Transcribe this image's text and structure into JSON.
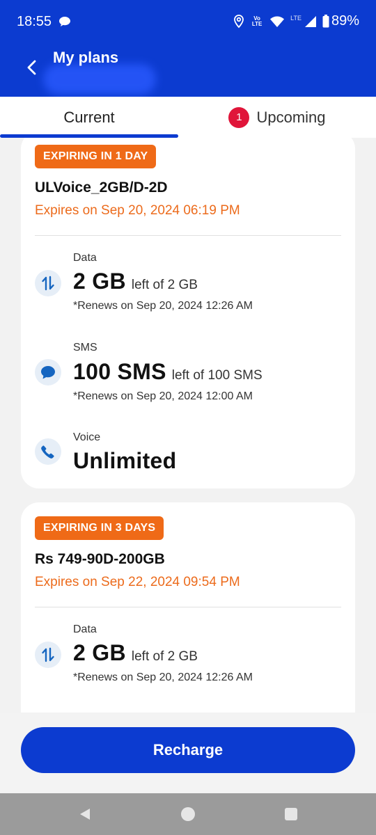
{
  "status_bar": {
    "time": "18:55",
    "battery": "89%",
    "volte_label": "Vo LTE",
    "lte_label": "LTE"
  },
  "header": {
    "title": "My plans"
  },
  "tabs": {
    "current": "Current",
    "upcoming": "Upcoming",
    "upcoming_count": "1"
  },
  "plans": [
    {
      "tag": "EXPIRING IN 1 DAY",
      "name": "ULVoice_2GB/D-2D",
      "expires": "Expires on Sep 20, 2024 06:19 PM",
      "benefits": {
        "data": {
          "label": "Data",
          "amount": "2 GB",
          "left_of": "left of 2 GB",
          "renews": "*Renews on Sep 20, 2024 12:26 AM"
        },
        "sms": {
          "label": "SMS",
          "amount": "100 SMS",
          "left_of": "left of 100 SMS",
          "renews": "*Renews on Sep 20, 2024 12:00 AM"
        },
        "voice": {
          "label": "Voice",
          "amount": "Unlimited"
        }
      }
    },
    {
      "tag": "EXPIRING IN 3 DAYS",
      "name": "Rs 749-90D-200GB",
      "expires": "Expires on Sep 22, 2024 09:54 PM",
      "benefits": {
        "data": {
          "label": "Data",
          "amount": "2 GB",
          "left_of": "left of 2 GB",
          "renews": "*Renews on Sep 20, 2024 12:26 AM"
        }
      }
    }
  ],
  "actions": {
    "recharge": "Recharge"
  },
  "colors": {
    "brand_blue": "#0c3bd0",
    "expiry_orange": "#ec6b1c",
    "badge_red": "#e0153a",
    "icon_blue": "#1565c0"
  },
  "icons": {
    "back": "chevron-left-icon",
    "data": "data-transfer-icon",
    "sms": "chat-bubble-icon",
    "voice": "phone-icon"
  }
}
